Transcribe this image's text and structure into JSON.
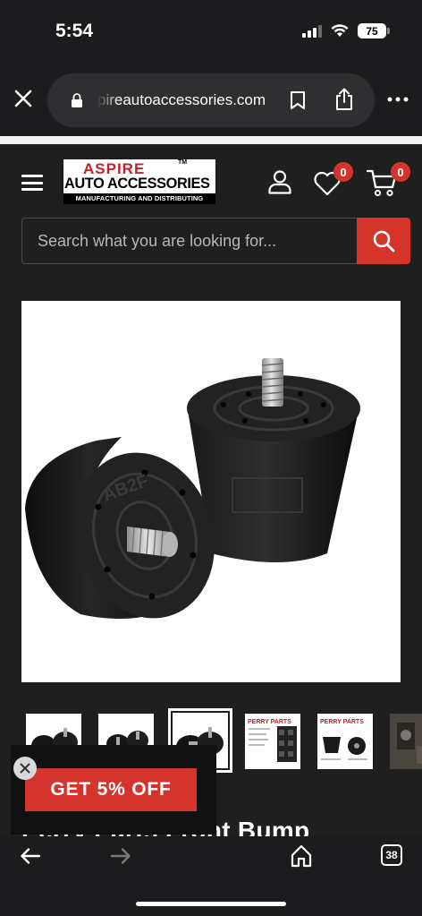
{
  "status_bar": {
    "time": "5:54",
    "battery": "75"
  },
  "browser": {
    "url": "pireautoaccessories.com",
    "icons": [
      "close-icon",
      "lock-icon",
      "bookmark-icon",
      "share-icon",
      "more-icon"
    ]
  },
  "header": {
    "logo_top": "ASPIRE",
    "logo_tm": "TM",
    "logo_main": "AUTO ACCESSORIES",
    "logo_sub": "MANUFACTURING AND DISTRIBUTING",
    "wishlist_count": "0",
    "cart_count": "0",
    "icons": [
      "menu-icon",
      "user-icon",
      "heart-icon",
      "cart-icon"
    ]
  },
  "search": {
    "placeholder": "Search what you are looking for..."
  },
  "product": {
    "title": "Perry Parts Front Bump",
    "image_subject": "two black bump stops with threaded studs",
    "thumbnail_count": 6,
    "active_thumbnail": 3,
    "thumb_brand_text": "PERRY PARTS"
  },
  "promo": {
    "label": "GET 5% OFF"
  },
  "bottom_nav": {
    "tab_count": "38",
    "icons": [
      "back-arrow-icon",
      "forward-arrow-icon",
      "home-icon",
      "tabs-icon"
    ]
  },
  "colors": {
    "accent": "#d4342c",
    "header_bg": "#1f1f1f",
    "browser_chrome": "#1c1c1e"
  }
}
